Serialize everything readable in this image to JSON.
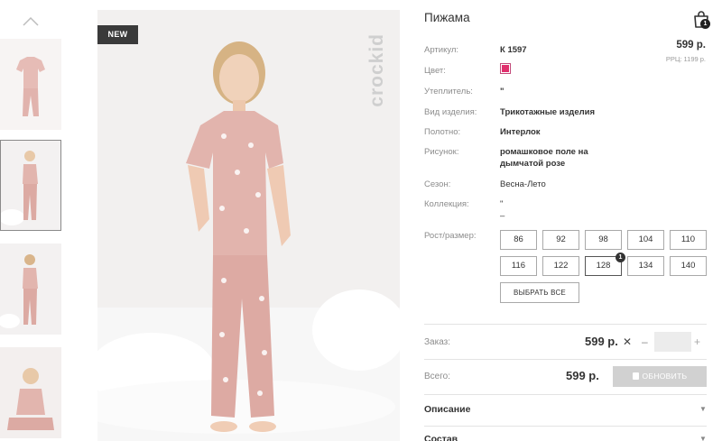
{
  "gallery": {
    "badge": "NEW",
    "brand_mark": "crockid"
  },
  "product": {
    "title": "Пижама",
    "cart_count": "1",
    "price": "599 р.",
    "rrp": "РРЦ: 1199 р.",
    "color_hex": "#e0306d",
    "attributes": [
      {
        "label": "Артикул:",
        "value": "К 1597"
      },
      {
        "label": "Цвет:",
        "value": ""
      },
      {
        "label": "Утеплитель:",
        "value": "\""
      },
      {
        "label": "Вид изделия:",
        "value": "Трикотажные изделия"
      },
      {
        "label": "Полотно:",
        "value": "Интерлок"
      },
      {
        "label": "Рисунок:",
        "value": "ромашковое поле на дымчатой розе"
      },
      {
        "label": "Сезон:",
        "value": "Весна-Лето"
      },
      {
        "label": "Коллекция:",
        "value": "\" –"
      }
    ]
  },
  "sizes": {
    "label": "Рост/размер:",
    "options": [
      "86",
      "92",
      "98",
      "104",
      "110",
      "116",
      "122",
      "128",
      "134",
      "140"
    ],
    "selected": "128",
    "selected_count": "1",
    "select_all_label": "ВЫБРАТЬ ВСЕ"
  },
  "order": {
    "label": "Заказ:",
    "price": "599 р.",
    "clear_icon": "close-icon",
    "minus": "–",
    "plus": "+",
    "quantity_value": ""
  },
  "total": {
    "label": "Всего:",
    "price": "599 р.",
    "update_label": "ОБНОВИТЬ"
  },
  "accordion": [
    {
      "label": "Описание"
    },
    {
      "label": "Состав"
    }
  ]
}
